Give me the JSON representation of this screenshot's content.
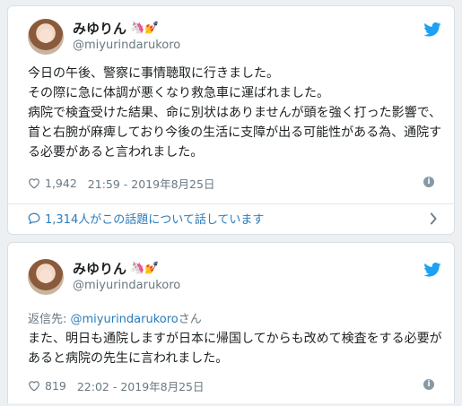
{
  "tweets": [
    {
      "user": {
        "name": "みゆりん",
        "handle": "@miyurindarukoro",
        "emojis": "🦄💅"
      },
      "reply_to": null,
      "text_lines": [
        "今日の午後、警察に事情聴取に行きました。",
        "その際に急に体調が悪くなり救急車に運ばれました。",
        "病院で検査受けた結果、命に別状はありませんが頭を強く打った影響で、首と右腕が麻痺しており今後の生活に支障が出る可能性がある為、通院する必要があると言われました。"
      ],
      "likes": "1,942",
      "timestamp": "21:59 - 2019年8月25日",
      "conversation": "1,314人がこの話題について話しています"
    },
    {
      "user": {
        "name": "みゆりん",
        "handle": "@miyurindarukoro",
        "emojis": "🦄💅"
      },
      "reply_to": {
        "prefix": "返信先: ",
        "handle": "@miyurindarukoro",
        "suffix": "さん"
      },
      "text_lines": [
        "また、明日も通院しますが日本に帰国してからも改めて検査をする必要があると病院の先生に言われました。"
      ],
      "likes": "819",
      "timestamp": "22:02 - 2019年8月25日"
    }
  ],
  "colors": {
    "link": "#2b7bb9",
    "muted": "#697882",
    "twitter_blue": "#1da1f2",
    "background": "#ecf0f3"
  },
  "icons": [
    "twitter-bird-icon",
    "heart-icon",
    "info-icon",
    "comment-bubble-icon",
    "chevron-right-icon"
  ]
}
